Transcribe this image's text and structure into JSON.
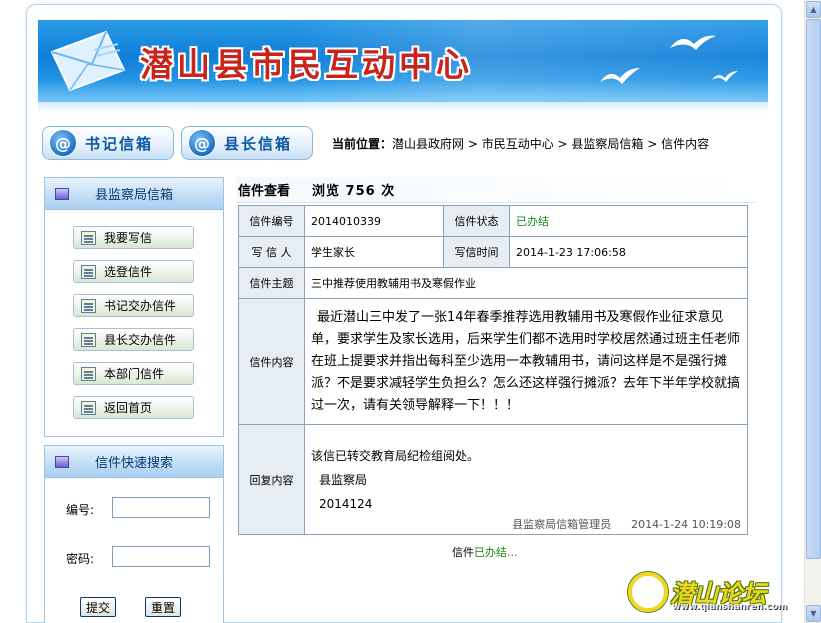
{
  "header": {
    "title": "潜山县市民互动中心"
  },
  "nav": {
    "secretary_mailbox": "书记信箱",
    "county_head_mailbox": "县长信箱"
  },
  "breadcrumb": {
    "prefix": "当前位置：",
    "items": [
      "潜山县政府网",
      "市民互动中心",
      "县监察局信箱",
      "信件内容"
    ],
    "separator": " > "
  },
  "sidebar": {
    "mailbox_title": "县监察局信箱",
    "menu": [
      {
        "label": "我要写信"
      },
      {
        "label": "选登信件"
      },
      {
        "label": "书记交办信件"
      },
      {
        "label": "县长交办信件"
      },
      {
        "label": "本部门信件"
      },
      {
        "label": "返回首页"
      }
    ],
    "search": {
      "title": "信件快速搜索",
      "number_label": "编号:",
      "number_value": "",
      "password_label": "密码:",
      "password_value": "",
      "submit_label": "提交",
      "reset_label": "重置"
    }
  },
  "letter": {
    "heading": "信件查看",
    "views_text": "浏览 756 次",
    "number_label": "信件编号",
    "number": "2014010339",
    "status_label": "信件状态",
    "status": "已办结",
    "writer_label": "写 信 人",
    "writer": "学生家长",
    "time_label": "写信时间",
    "time": "2014-1-23 17:06:58",
    "subject_label": "信件主题",
    "subject": "三中推荐使用教辅用书及寒假作业",
    "content_label": "信件内容",
    "content": "最近潜山三中发了一张14年春季推荐选用教辅用书及寒假作业征求意见单，要求学生及家长选用，后来学生们都不选用时学校居然通过班主任老师在班上提要求并指出每科至少选用一本教辅用书，请问这样是不是强行摊派？不是要求减轻学生负担么？怎么还这样强行摊派？去年下半年学校就搞过一次，请有关领导解释一下！！！",
    "reply_label": "回复内容",
    "reply_lines": [
      "该信已转交教育局纪检组阅处。",
      "县监察局",
      "2014124"
    ],
    "reply_signer": "县监察局信箱管理员",
    "reply_time": "2014-1-24 10:19:08",
    "footer_prefix": "信件",
    "footer_status": "已办结..."
  },
  "watermark": {
    "name": "潜山论坛",
    "url": "www.qianshanren.com"
  },
  "colors": {
    "banner_blue": "#0f7fd8",
    "title_red": "#c8241b",
    "status_green": "#138a13",
    "label_bg": "#e6edf3"
  }
}
